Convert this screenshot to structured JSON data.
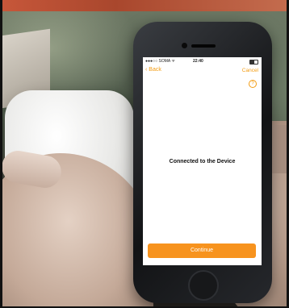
{
  "status_bar": {
    "carrier": "●●●○○ SOMA ᯤ",
    "time": "22:40"
  },
  "nav": {
    "back_label": "Back",
    "cancel_label": "Cancel",
    "help_glyph": "?"
  },
  "screen": {
    "message": "Connected to the Device",
    "continue_label": "Continue"
  },
  "colors": {
    "accent": "#f7931e",
    "nav_text": "#f39c12"
  },
  "icons": {
    "back": "chevron-left-icon",
    "help": "question-circle-icon",
    "battery": "battery-icon"
  }
}
